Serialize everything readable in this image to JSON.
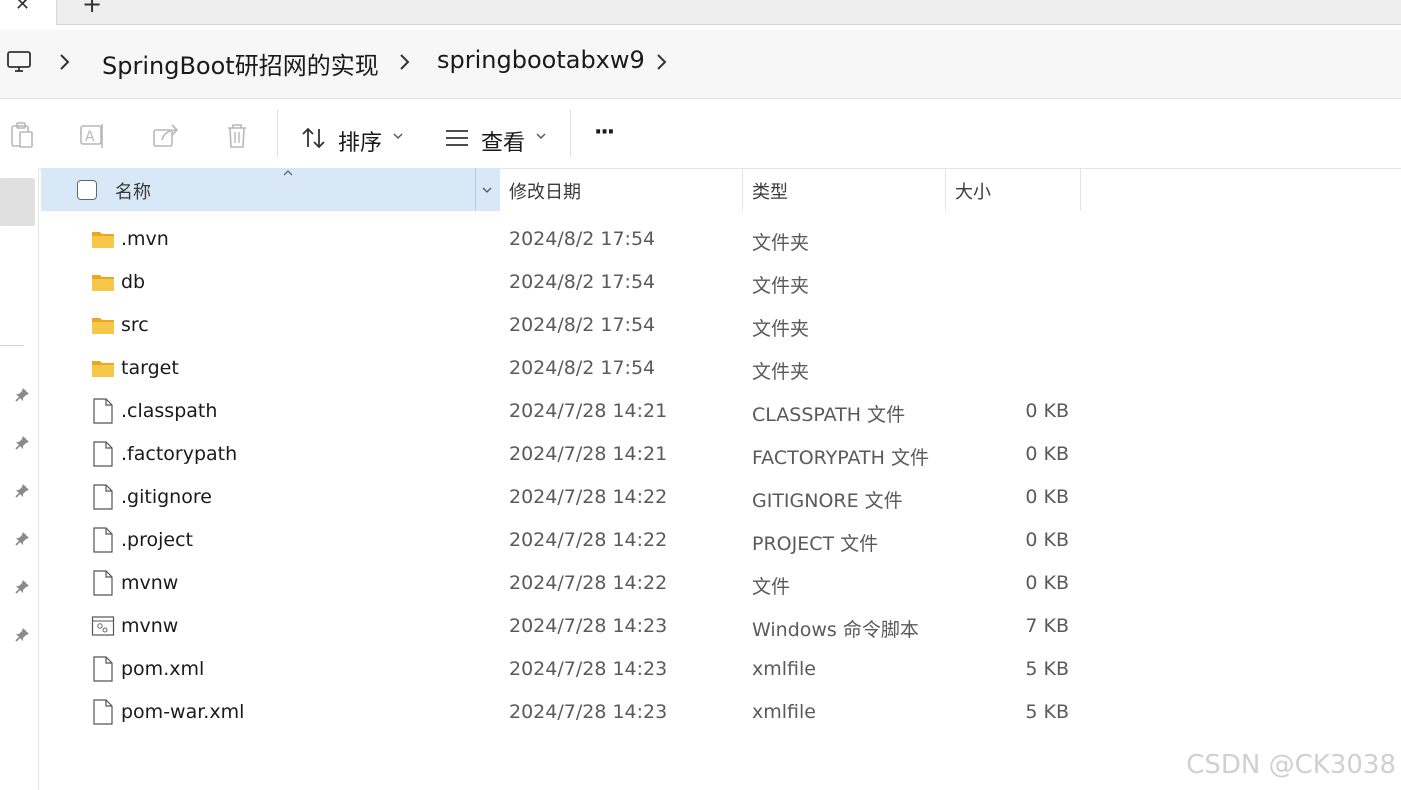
{
  "tabs": {
    "close_glyph": "✕",
    "new_tab_glyph": "+"
  },
  "breadcrumb": {
    "items": [
      "SpringBoot研招网的实现",
      "springbootabxw9"
    ]
  },
  "toolbar": {
    "sort_label": "排序",
    "view_label": "查看",
    "more_label": "···"
  },
  "columns": {
    "name": "名称",
    "date": "修改日期",
    "type": "类型",
    "size": "大小"
  },
  "files": [
    {
      "name": ".mvn",
      "date": "2024/8/2 17:54",
      "type": "文件夹",
      "size": "",
      "icon": "folder-icon"
    },
    {
      "name": "db",
      "date": "2024/8/2 17:54",
      "type": "文件夹",
      "size": "",
      "icon": "folder-icon"
    },
    {
      "name": "src",
      "date": "2024/8/2 17:54",
      "type": "文件夹",
      "size": "",
      "icon": "folder-icon"
    },
    {
      "name": "target",
      "date": "2024/8/2 17:54",
      "type": "文件夹",
      "size": "",
      "icon": "folder-icon"
    },
    {
      "name": ".classpath",
      "date": "2024/7/28 14:21",
      "type": "CLASSPATH 文件",
      "size": "0 KB",
      "icon": "file-icon"
    },
    {
      "name": ".factorypath",
      "date": "2024/7/28 14:21",
      "type": "FACTORYPATH 文件",
      "size": "0 KB",
      "icon": "file-icon"
    },
    {
      "name": ".gitignore",
      "date": "2024/7/28 14:22",
      "type": "GITIGNORE 文件",
      "size": "0 KB",
      "icon": "file-icon"
    },
    {
      "name": ".project",
      "date": "2024/7/28 14:22",
      "type": "PROJECT 文件",
      "size": "0 KB",
      "icon": "file-icon"
    },
    {
      "name": "mvnw",
      "date": "2024/7/28 14:22",
      "type": "文件",
      "size": "0 KB",
      "icon": "file-icon"
    },
    {
      "name": "mvnw",
      "date": "2024/7/28 14:23",
      "type": "Windows 命令脚本",
      "size": "7 KB",
      "icon": "script-file-icon"
    },
    {
      "name": "pom.xml",
      "date": "2024/7/28 14:23",
      "type": "xmlfile",
      "size": "5 KB",
      "icon": "file-icon"
    },
    {
      "name": "pom-war.xml",
      "date": "2024/7/28 14:23",
      "type": "xmlfile",
      "size": "5 KB",
      "icon": "file-icon"
    }
  ],
  "watermark": "CSDN @CK3038",
  "colors": {
    "header_selected": "#d9e8f7",
    "folder": "#f8c74a",
    "folder_dark": "#e8a921"
  }
}
